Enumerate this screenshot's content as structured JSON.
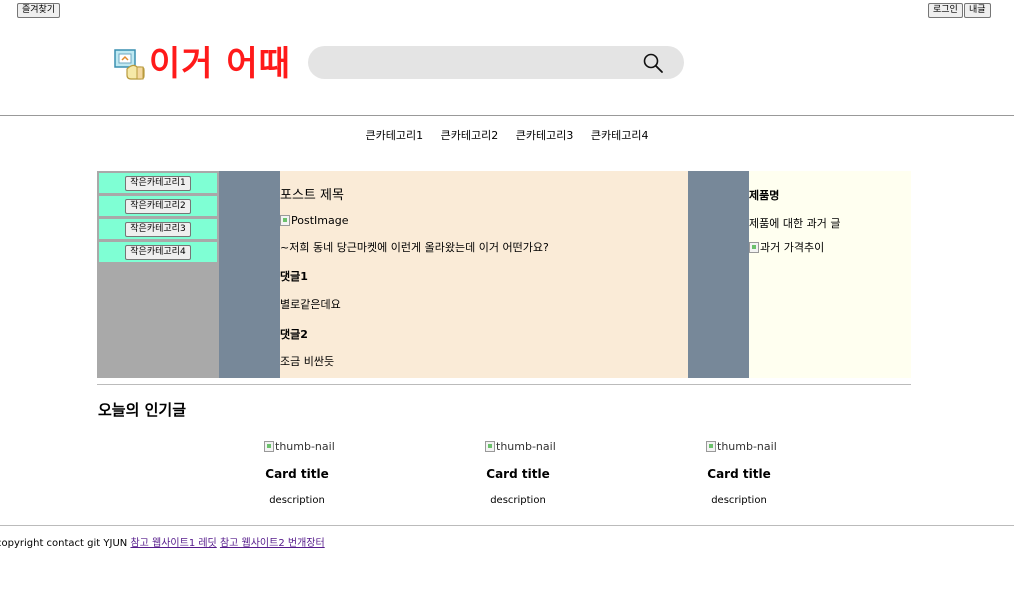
{
  "top_bar": {
    "favorites_label": "즐겨찾기",
    "login_label": "로그인",
    "my_label": "내글"
  },
  "header": {
    "logo_text": "이거 어때",
    "search_placeholder": ""
  },
  "nav": {
    "categories": [
      "큰카테고리1",
      "큰카테고리2",
      "큰카테고리3",
      "큰카테고리4"
    ]
  },
  "sidebar": {
    "small_categories": [
      "작은카테고리1",
      "작은카테고리2",
      "작은카테고리3",
      "작은카테고리4"
    ]
  },
  "post": {
    "title": "포스트 제목",
    "image_alt": "PostImage",
    "body": "~저희 동네 당근마켓에 이런게 올라왔는데 이거 어떤가요?",
    "comments": [
      {
        "heading": "댓글1",
        "text": "별로같은데요"
      },
      {
        "heading": "댓글2",
        "text": "조금 비싼듯"
      }
    ]
  },
  "product": {
    "name": "제품명",
    "description": "제품에 대한 과거 글",
    "image_alt": "과거 가격추이"
  },
  "popular": {
    "title": "오늘의 인기글",
    "cards": [
      {
        "thumb_alt": "thumb-nail",
        "title": "Card title",
        "description": "description"
      },
      {
        "thumb_alt": "thumb-nail",
        "title": "Card title",
        "description": "description"
      },
      {
        "thumb_alt": "thumb-nail",
        "title": "Card title",
        "description": "description"
      }
    ]
  },
  "footer": {
    "text": "copyright contact git YJUN",
    "links": [
      "참고 웹사이트1 레딧",
      "참고 웹사이트2 번개장터"
    ]
  },
  "colors": {
    "logo": "#ff1a1a",
    "small_category_bg": "#7fffd4",
    "sidebar_bg": "#a9a9a9",
    "spacer_bg": "#778899",
    "post_bg": "#faebd7",
    "product_bg": "#fffff0"
  },
  "icons": {
    "logo": "logo-icon",
    "search": "search-icon",
    "broken_image": "broken-image-icon"
  }
}
